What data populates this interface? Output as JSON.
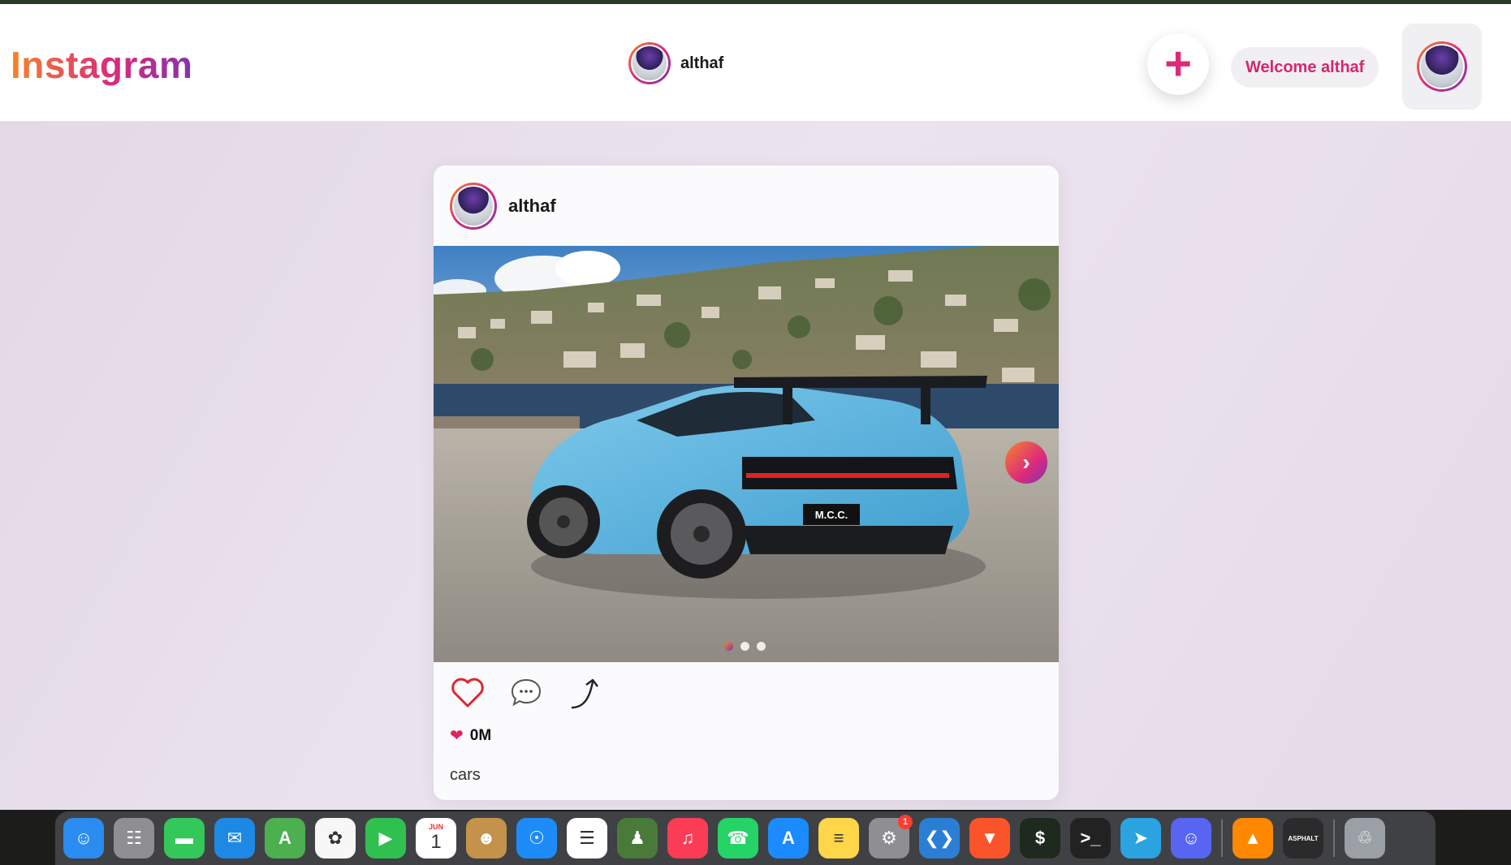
{
  "header": {
    "logo": "Instagram",
    "username": "althaf",
    "add_label": "+",
    "welcome": "Welcome althaf"
  },
  "post": {
    "username": "althaf",
    "image_alt": "cars",
    "plate_text": "M.C.C.",
    "next_label": "›",
    "slides": 3,
    "active_slide": 1,
    "likes_count": "0M",
    "caption": "cars"
  },
  "dock": {
    "items": [
      {
        "name": "finder",
        "label": "☺",
        "color": "#2a8cf0"
      },
      {
        "name": "launchpad",
        "label": "☷",
        "color": "#8e8e93"
      },
      {
        "name": "messages",
        "label": "▬",
        "color": "#34c759"
      },
      {
        "name": "mail",
        "label": "✉",
        "color": "#1e88e5"
      },
      {
        "name": "maps",
        "label": "A",
        "color": "#4caf50"
      },
      {
        "name": "photos",
        "label": "✿",
        "color": "#f7f7f7"
      },
      {
        "name": "facetime",
        "label": "▶",
        "color": "#30c04f"
      },
      {
        "name": "calendar",
        "label": "1",
        "month": "JUN",
        "color": "#ffffff"
      },
      {
        "name": "contacts",
        "label": "☻",
        "color": "#c4924b"
      },
      {
        "name": "safari",
        "label": "☉",
        "color": "#1d8cf8"
      },
      {
        "name": "reminders",
        "label": "☰",
        "color": "#ffffff"
      },
      {
        "name": "chess",
        "label": "♟",
        "color": "#4a7a3a"
      },
      {
        "name": "music",
        "label": "♫",
        "color": "#fb3c56"
      },
      {
        "name": "whatsapp",
        "label": "☎",
        "color": "#25d366"
      },
      {
        "name": "app-store",
        "label": "A",
        "color": "#1a8cff"
      },
      {
        "name": "notes",
        "label": "≡",
        "color": "#ffd54a"
      },
      {
        "name": "system-settings",
        "label": "⚙",
        "color": "#8e8e93",
        "badge": "1"
      },
      {
        "name": "vscode",
        "label": "❮❯",
        "color": "#2a7fd4"
      },
      {
        "name": "brave",
        "label": "▼",
        "color": "#fb542b"
      },
      {
        "name": "iterm",
        "label": "$",
        "color": "#1f2a1f"
      },
      {
        "name": "terminal",
        "label": ">_",
        "color": "#222222"
      },
      {
        "name": "telegram",
        "label": "➤",
        "color": "#2aa3e0"
      },
      {
        "name": "discord",
        "label": "☺",
        "color": "#5865f2"
      },
      {
        "name": "vlc",
        "label": "▲",
        "color": "#ff8800"
      },
      {
        "name": "asphalt",
        "label": "ASPHALT",
        "color": "#2b2b2b"
      },
      {
        "name": "trash",
        "label": "♲",
        "color": "#9aa0a6"
      }
    ]
  }
}
